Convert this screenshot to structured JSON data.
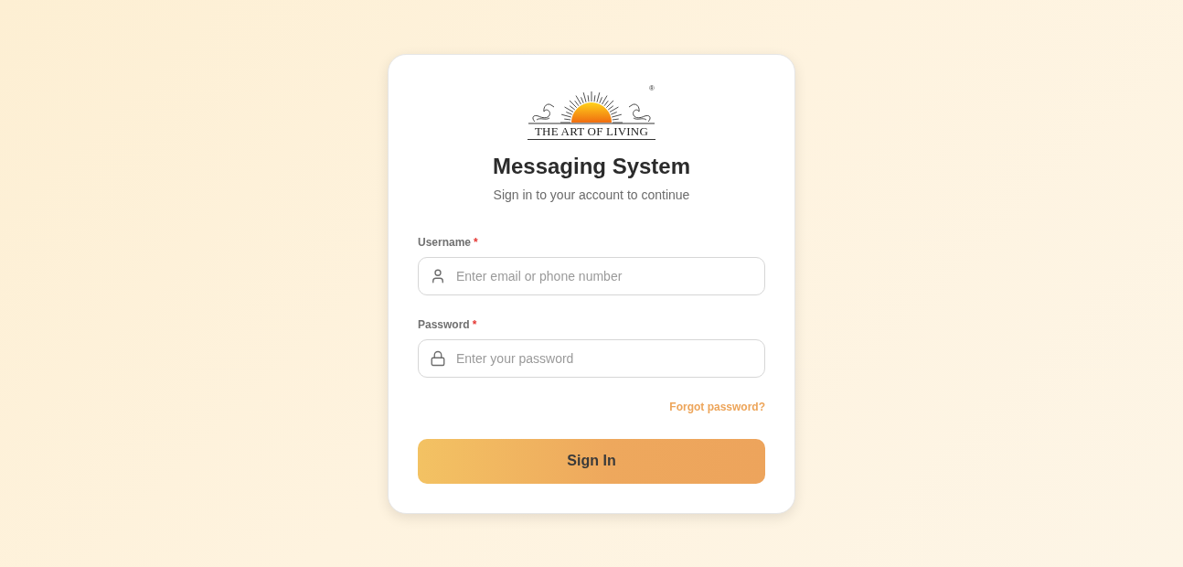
{
  "logo": {
    "text": "THE ART OF LIVING",
    "mark": "®"
  },
  "title": "Messaging System",
  "subtitle": "Sign in to your account to continue",
  "fields": [
    {
      "kind": "user",
      "label": "Username",
      "required_mark": "*",
      "placeholder": "Enter email or phone number"
    },
    {
      "kind": "lock",
      "label": "Password",
      "required_mark": "*",
      "placeholder": "Enter your password"
    }
  ],
  "forgot_link": "Forgot password?",
  "submit_button": "Sign In"
}
